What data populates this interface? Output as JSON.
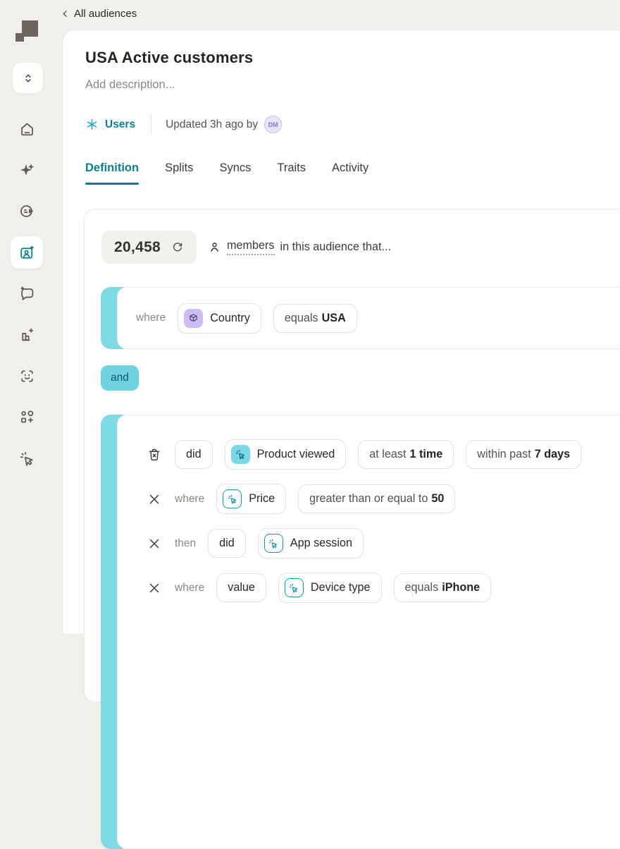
{
  "colors": {
    "accent_teal": "#0E7D8C",
    "teal_bar": "#7EDAE4",
    "and_chip_bg": "#6FD2DF",
    "property_icon_bg": "#C9BDF4",
    "event_icon_bg": "#7CD8E4",
    "avatar_bg": "#EAE5FA",
    "page_bg": "#F0EFEC"
  },
  "breadcrumb": {
    "label": "All audiences"
  },
  "sidebar": {
    "items": [
      {
        "icon": "home-icon"
      },
      {
        "icon": "ai-sparkle-icon"
      },
      {
        "icon": "journeys-face-icon"
      },
      {
        "icon": "audiences-card-icon",
        "active": true
      },
      {
        "icon": "chat-sparkle-icon"
      },
      {
        "icon": "chart-plus-icon"
      },
      {
        "icon": "face-scan-icon"
      },
      {
        "icon": "apps-plus-icon"
      },
      {
        "icon": "cursor-sparkle-icon"
      }
    ]
  },
  "header": {
    "title": "USA Active customers",
    "description_placeholder": "Add description...",
    "entity_label": "Users",
    "updated_text": "Updated 3h ago by",
    "avatar_initials": "DM"
  },
  "tabs": {
    "items": [
      {
        "label": "Definition",
        "active": true
      },
      {
        "label": "Splits"
      },
      {
        "label": "Syncs"
      },
      {
        "label": "Traits"
      },
      {
        "label": "Activity"
      }
    ]
  },
  "summary": {
    "count": "20,458",
    "members_label": "members",
    "suffix_text": "in this audience that..."
  },
  "builder": {
    "connector_label": "and",
    "group1": {
      "keyword": "where",
      "property_label": "Country",
      "operator_muted": "equals",
      "operator_value": "USA"
    },
    "group2": {
      "row1": {
        "keyword_chip": "did",
        "event_label": "Product viewed",
        "frequency_muted": "at least",
        "frequency_value": "1 time",
        "window_muted": "within past",
        "window_value": "7 days"
      },
      "row2": {
        "keyword": "where",
        "property_label": "Price",
        "operator_muted": "greater than or equal to",
        "operator_value": "50"
      },
      "row3": {
        "keyword": "then",
        "keyword_chip": "did",
        "event_label": "App session"
      },
      "row4": {
        "keyword": "where",
        "value_chip": "value",
        "property_label": "Device type",
        "operator_muted": "equals",
        "operator_value": "iPhone"
      }
    }
  }
}
